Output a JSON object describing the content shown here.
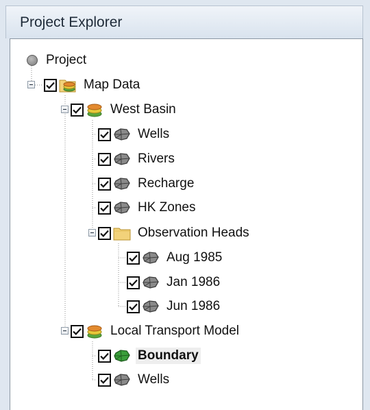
{
  "panel": {
    "title": "Project Explorer"
  },
  "tree": {
    "root": {
      "label": "Project"
    },
    "map_data": {
      "label": "Map Data"
    },
    "west_basin": {
      "label": "West Basin"
    },
    "wells": {
      "label": "Wells"
    },
    "rivers": {
      "label": "Rivers"
    },
    "recharge": {
      "label": "Recharge"
    },
    "hk_zones": {
      "label": "HK Zones"
    },
    "observation_heads": {
      "label": "Observation Heads"
    },
    "aug_1985": {
      "label": "Aug 1985"
    },
    "jan_1986": {
      "label": "Jan 1986"
    },
    "jun_1986": {
      "label": "Jun 1986"
    },
    "local_transport_model": {
      "label": "Local Transport Model"
    },
    "boundary": {
      "label": "Boundary",
      "selected": true
    },
    "wells_2": {
      "label": "Wells"
    }
  },
  "colors": {
    "coverage_gray": "#8a8a8a",
    "coverage_green": "#3a9e3a",
    "folder_yellow": "#f2d27a",
    "selection_background": "#eeeeee"
  },
  "icons": {
    "root": "project-node-icon",
    "map_data": "map-data-folder-icon",
    "model": "conceptual-model-icon",
    "coverage": "coverage-icon",
    "folder": "folder-icon"
  }
}
